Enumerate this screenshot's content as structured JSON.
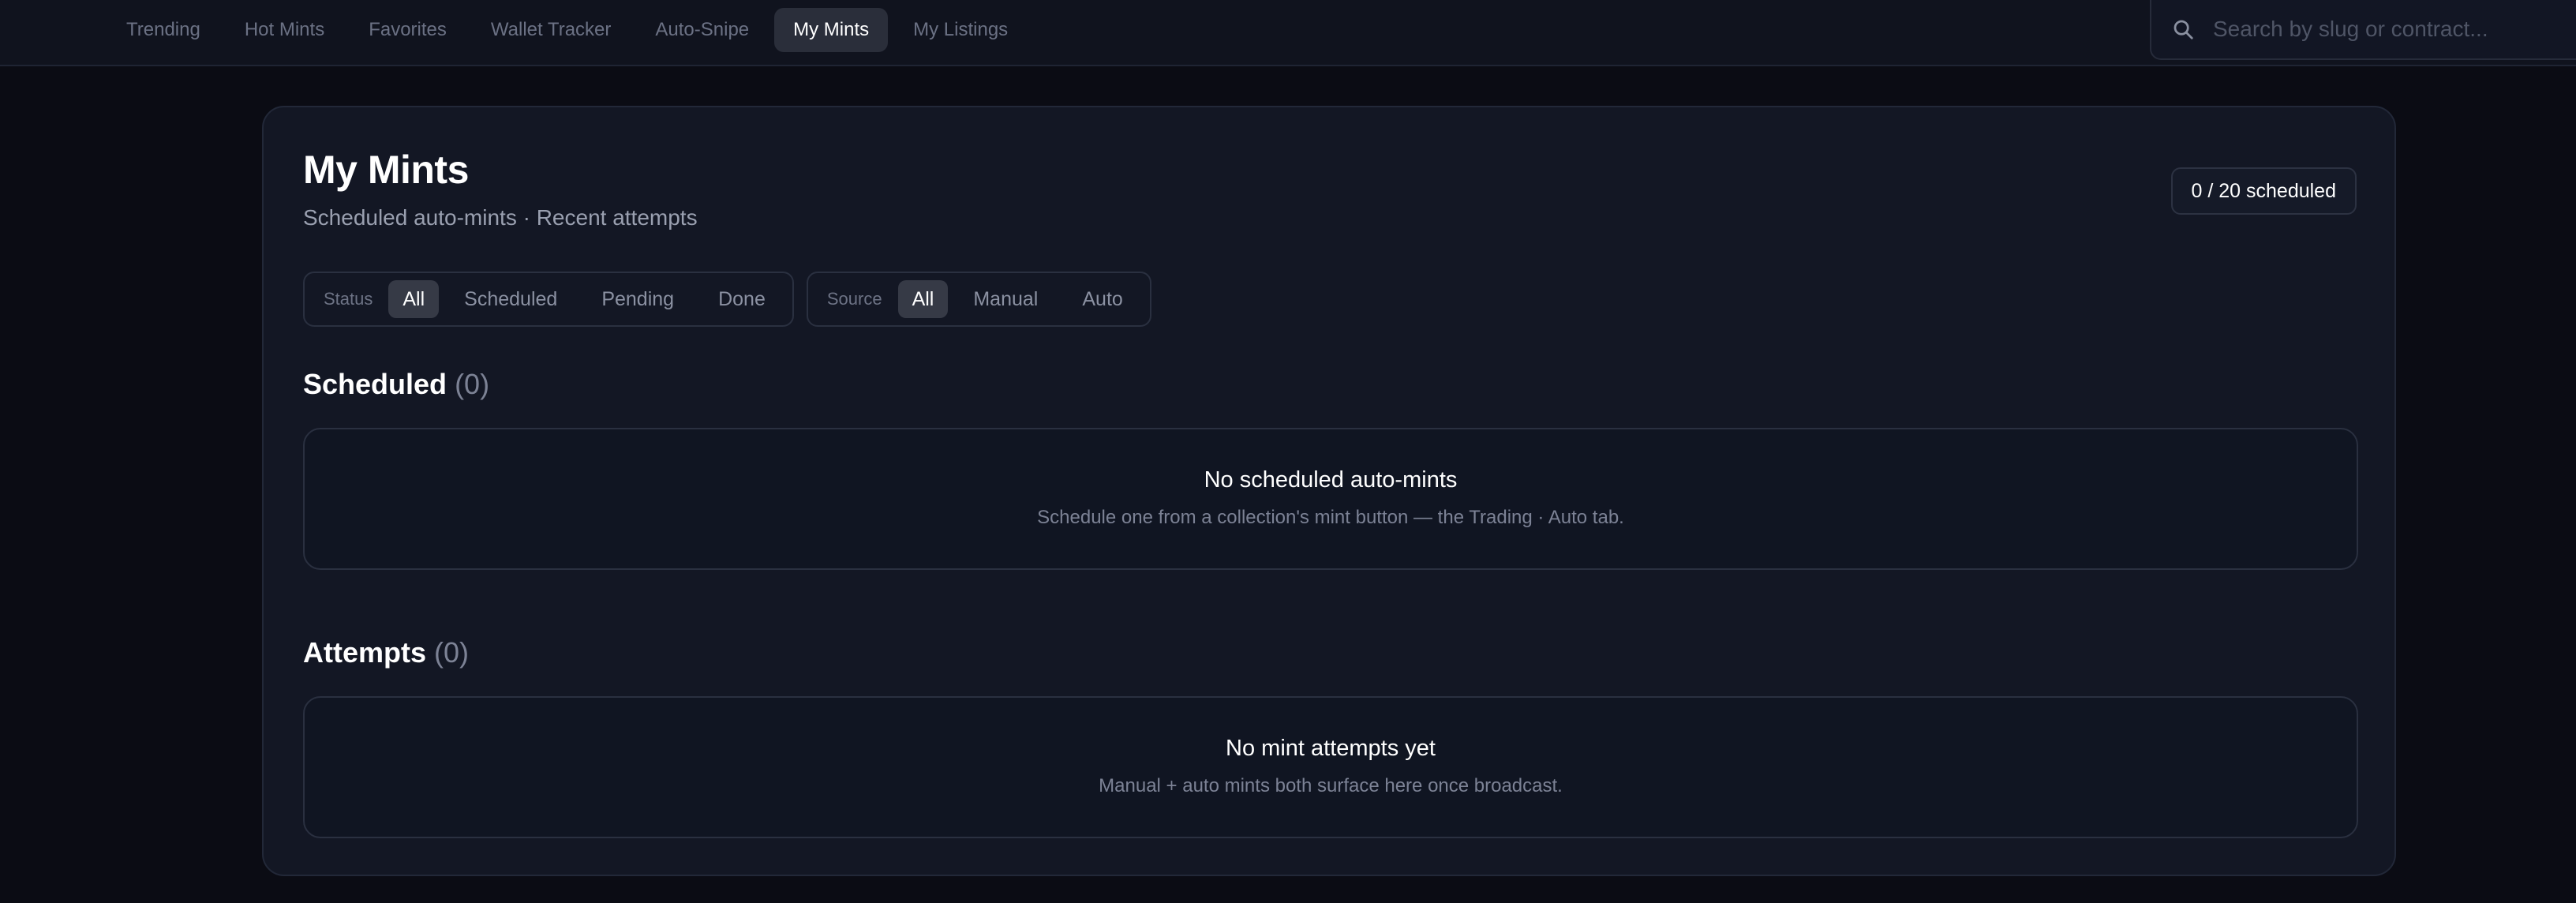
{
  "nav": {
    "tabs": [
      {
        "label": "Trending",
        "active": false
      },
      {
        "label": "Hot Mints",
        "active": false
      },
      {
        "label": "Favorites",
        "active": false
      },
      {
        "label": "Wallet Tracker",
        "active": false
      },
      {
        "label": "Auto-Snipe",
        "active": false
      },
      {
        "label": "My Mints",
        "active": true
      },
      {
        "label": "My Listings",
        "active": false
      }
    ]
  },
  "search": {
    "placeholder": "Search by slug or contract...",
    "value": "",
    "icon": "search-icon"
  },
  "page": {
    "title": "My Mints",
    "subtitle": "Scheduled auto-mints · Recent attempts",
    "badge": "0 / 20 scheduled"
  },
  "filters": {
    "status": {
      "label": "Status",
      "options": [
        "All",
        "Scheduled",
        "Pending",
        "Done"
      ],
      "selected": "All"
    },
    "source": {
      "label": "Source",
      "options": [
        "All",
        "Manual",
        "Auto"
      ],
      "selected": "All"
    }
  },
  "scheduled": {
    "heading": "Scheduled",
    "count": "(0)",
    "empty_title": "No scheduled auto-mints",
    "empty_sub": "Schedule one from a collection's mint button — the Trading · Auto tab."
  },
  "attempts": {
    "heading": "Attempts",
    "count": "(0)",
    "empty_title": "No mint attempts yet",
    "empty_sub": "Manual + auto mints both surface here once broadcast."
  },
  "colors": {
    "background": "#0b0c14",
    "card": "#131724",
    "active_tab": "#2a2e3a",
    "muted_text": "#7c8295"
  }
}
